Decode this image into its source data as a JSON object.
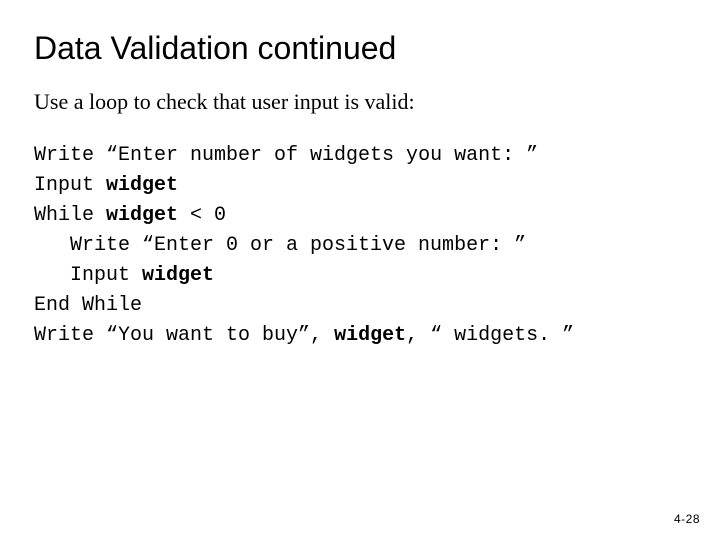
{
  "title": "Data Validation continued",
  "subtitle": "Use a loop to check that user input is valid:",
  "code": {
    "l1a": "Write “Enter number of widgets you want: ”",
    "l2a": "Input ",
    "l2b": "widget",
    "l3a": "While ",
    "l3b": "widget",
    "l3c": " < 0",
    "l4a": "Write “Enter 0 or a positive number: ”",
    "l5a": "Input ",
    "l5b": "widget",
    "l6a": "End While",
    "l7a": "Write “You want to buy”, ",
    "l7b": "widget",
    "l7c": ", “ widgets. ”"
  },
  "page_number": "4-28"
}
